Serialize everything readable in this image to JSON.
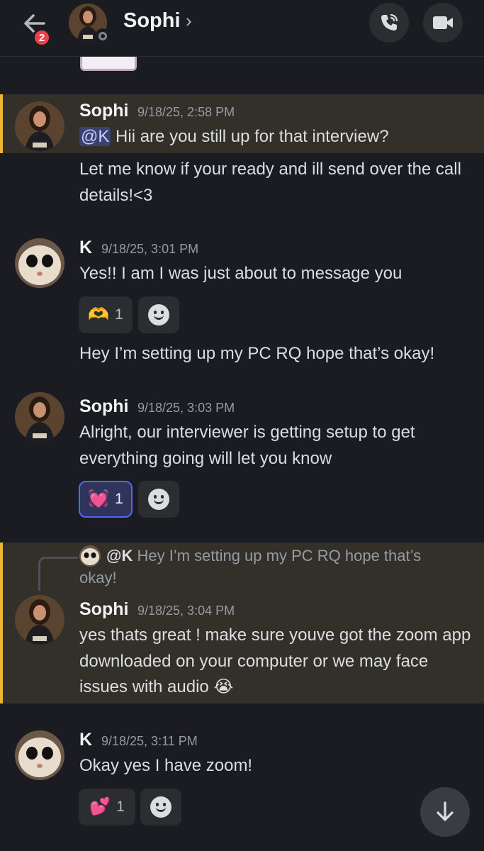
{
  "header": {
    "unread_count": "2",
    "contact_name": "Sophi",
    "chevron": "›",
    "icons": {
      "back": "arrow-left-icon",
      "call": "phone-call-icon",
      "video": "video-camera-icon"
    }
  },
  "messages": [
    {
      "author": "Sophi",
      "timestamp": "9/18/25, 2:58 PM",
      "mention": "@K",
      "text": " Hii are you still up for that interview?"
    },
    {
      "text": "Let me know if your ready and ill send over the call details!<3"
    },
    {
      "author": "K",
      "timestamp": "9/18/25, 3:01 PM",
      "text": "Yes!! I am I was just about to message you",
      "reaction": {
        "emoji": "🫶",
        "count": "1"
      }
    },
    {
      "text": "Hey I’m setting up my PC RQ hope that’s okay!"
    },
    {
      "author": "Sophi",
      "timestamp": "9/18/25, 3:03 PM",
      "text": "Alright, our interviewer is getting setup to get everything going will let you know",
      "reaction": {
        "emoji": "💓",
        "count": "1"
      }
    },
    {
      "reply_to": {
        "mention": "@K",
        "text": " Hey I’m setting up my PC RQ hope that’s okay!"
      },
      "author": "Sophi",
      "timestamp": "9/18/25, 3:04 PM",
      "text": "yes thats great ! make sure youve got the zoom app downloaded on your computer or we may face issues with audio 😭"
    },
    {
      "author": "K",
      "timestamp": "9/18/25, 3:11 PM",
      "text": "Okay yes I have zoom!",
      "reaction": {
        "emoji": "💕",
        "count": "1"
      }
    }
  ],
  "colors": {
    "background": "#1b1c22",
    "highlight": "#33302a",
    "highlight_border": "#f0b232",
    "accent": "#5865f2",
    "badge": "#ed4245"
  }
}
